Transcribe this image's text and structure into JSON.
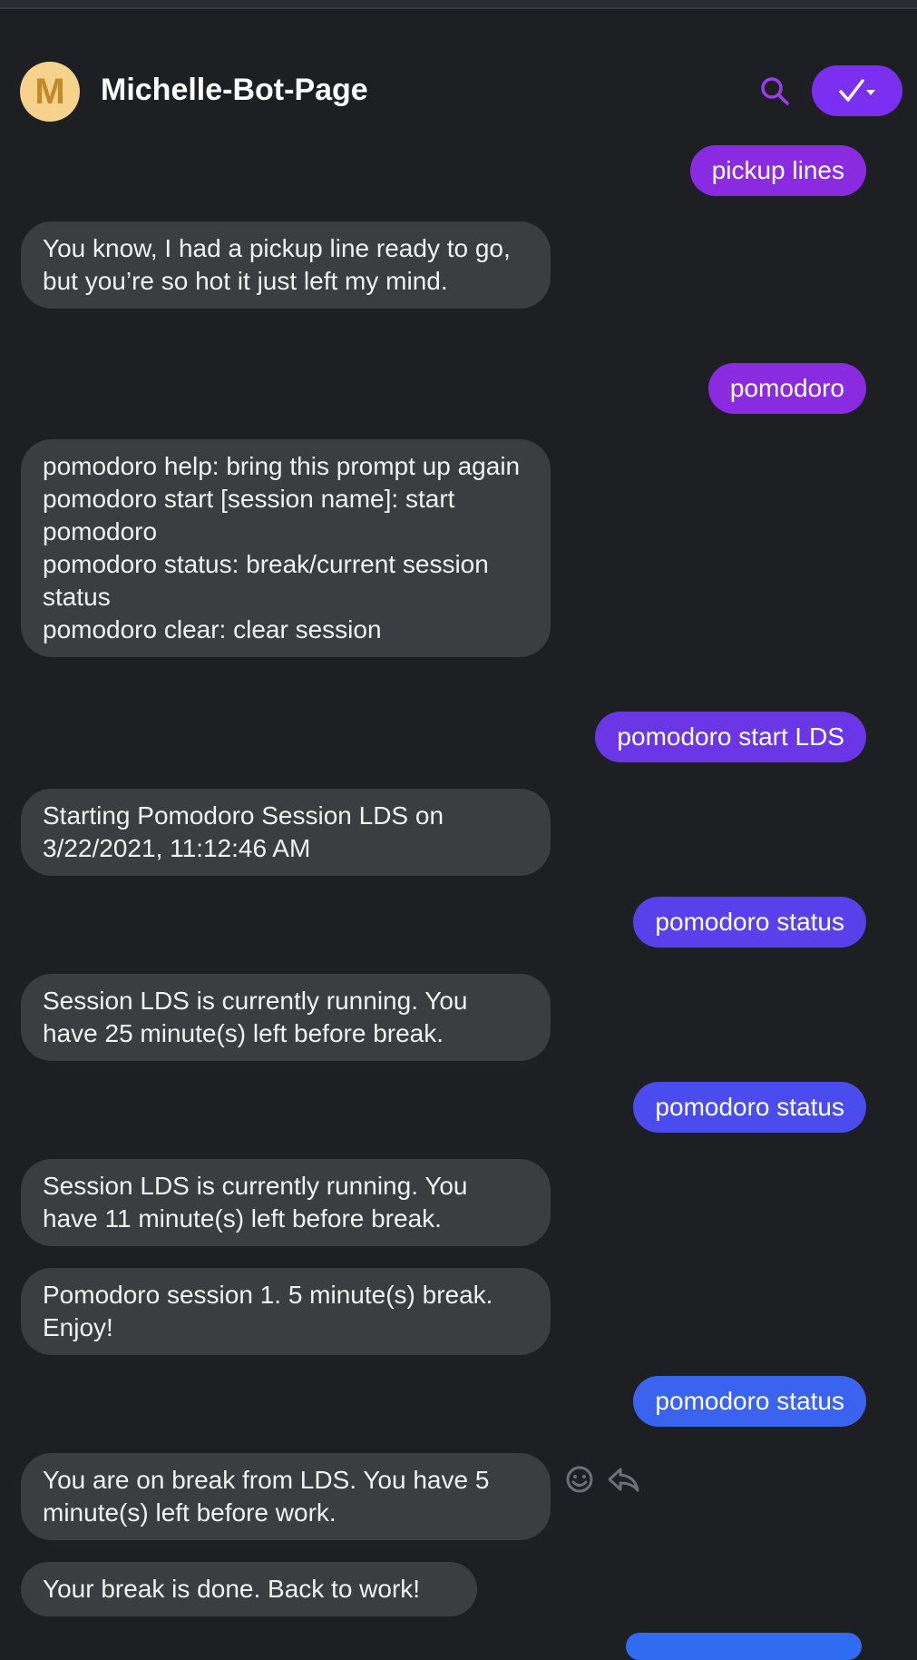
{
  "header": {
    "avatar_letter": "M",
    "title": "Michelle-Bot-Page",
    "search_icon": "search-icon",
    "action_icon": "check-dropdown-icon",
    "accent_color": "#7b2ff0"
  },
  "messages": [
    {
      "from": "user",
      "text": "pickup lines",
      "color": "#8a2be2"
    },
    {
      "from": "bot",
      "text": "You know, I had a pickup line ready to go, but you’re so hot it just left my mind."
    },
    {
      "from": "user",
      "text": "pomodoro",
      "color": "#8a2be2"
    },
    {
      "from": "bot",
      "text": "pomodoro help: bring this prompt up again\npomodoro start [session name]: start pomodoro\npomodoro status: break/current session status\npomodoro clear: clear session"
    },
    {
      "from": "user",
      "text": "pomodoro start LDS",
      "color": "#6a36e6"
    },
    {
      "from": "bot",
      "text": "Starting Pomodoro Session LDS on 3/22/2021, 11:12:46 AM"
    },
    {
      "from": "user",
      "text": "pomodoro status",
      "color": "#5a40ea"
    },
    {
      "from": "bot",
      "text": "Session LDS is currently running. You have 25 minute(s) left before break."
    },
    {
      "from": "user",
      "text": "pomodoro status",
      "color": "#4a4cee"
    },
    {
      "from": "bot",
      "text": "Session LDS is currently running. You have 11 minute(s) left before break."
    },
    {
      "from": "bot",
      "text": "Pomodoro session 1. 5 minute(s) break. Enjoy!"
    },
    {
      "from": "user",
      "text": "pomodoro status",
      "color": "#3a64f0"
    },
    {
      "from": "bot",
      "text": "You are on break from LDS. You have 5 minute(s) left before work."
    },
    {
      "from": "bot",
      "text": "Your break is done. Back to work!"
    }
  ],
  "reactions": {
    "emoji_icon": "emoji-icon",
    "reply_icon": "reply-icon"
  },
  "bottom_peek_color": "#2f6cf2"
}
